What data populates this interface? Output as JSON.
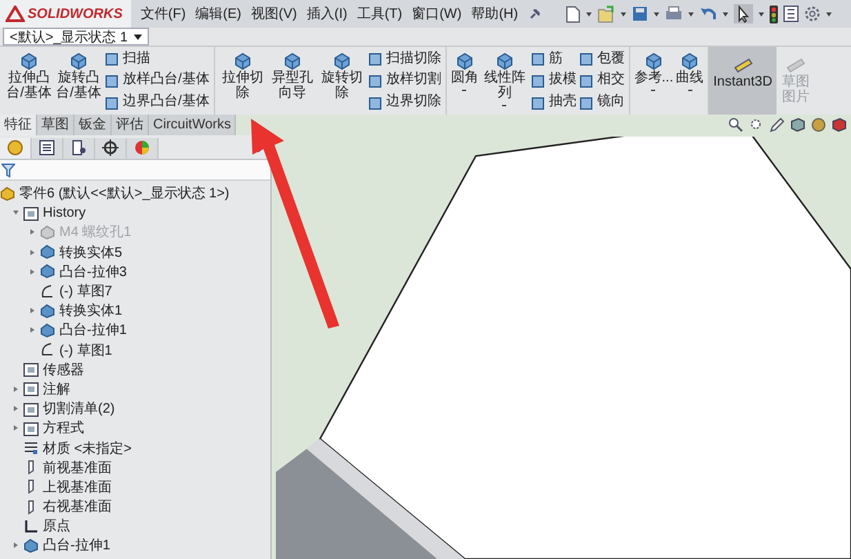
{
  "app": {
    "logo": "SOLIDWORKS"
  },
  "menu": [
    "文件(F)",
    "编辑(E)",
    "视图(V)",
    "插入(I)",
    "工具(T)",
    "窗口(W)",
    "帮助(H)"
  ],
  "config": {
    "value": "<默认>_显示状态 1"
  },
  "command_groups": [
    {
      "big": [
        {
          "label": "拉伸凸台/基体",
          "dropdown": false
        },
        {
          "label": "旋转凸台/基体",
          "dropdown": false
        }
      ],
      "small": [
        [
          "扫描",
          "放样凸台/基体",
          "边界凸台/基体"
        ]
      ]
    },
    {
      "big": [
        {
          "label": "拉伸切除",
          "dropdown": false
        },
        {
          "label": "异型孔向导",
          "dropdown": false
        },
        {
          "label": "旋转切除",
          "dropdown": false
        }
      ],
      "small": [
        [
          "扫描切除",
          "放样切割",
          "边界切除"
        ]
      ]
    },
    {
      "big": [
        {
          "label": "圆角",
          "dropdown": true
        },
        {
          "label": "线性阵列",
          "dropdown": true
        }
      ],
      "small": [
        [
          "筋",
          "拔模",
          "抽壳"
        ],
        [
          "包覆",
          "相交",
          "镜向"
        ]
      ]
    },
    {
      "big": [
        {
          "label": "参考...",
          "dropdown": true
        },
        {
          "label": "曲线",
          "dropdown": true
        }
      ]
    }
  ],
  "toggles": [
    {
      "label": "Instant3D",
      "selected": true,
      "disabled": false
    },
    {
      "label": "草图图片",
      "selected": false,
      "disabled": true
    }
  ],
  "tabs": [
    {
      "label": "特征",
      "selected": true
    },
    {
      "label": "草图",
      "selected": false
    },
    {
      "label": "钣金",
      "selected": false
    },
    {
      "label": "评估",
      "selected": false
    },
    {
      "label": "CircuitWorks",
      "selected": false
    }
  ],
  "tree": {
    "root": "零件6 (默认<<默认>_显示状态 1>)",
    "items": [
      {
        "label": "History",
        "kind": "folder",
        "expanded": true,
        "children": [
          {
            "label": "M4 螺纹孔1",
            "kind": "feature",
            "expanded": false,
            "suppressed": true
          },
          {
            "label": "转换实体5",
            "kind": "feature",
            "expanded": false,
            "suppressed": false
          },
          {
            "label": "凸台-拉伸3",
            "kind": "feature",
            "expanded": false,
            "suppressed": false
          },
          {
            "label": "(-) 草图7",
            "kind": "sketch",
            "suppressed": false
          },
          {
            "label": "转换实体1",
            "kind": "feature",
            "expanded": false,
            "suppressed": false
          },
          {
            "label": "凸台-拉伸1",
            "kind": "feature",
            "expanded": false,
            "suppressed": false
          },
          {
            "label": "(-) 草图1",
            "kind": "sketch",
            "suppressed": false
          }
        ]
      },
      {
        "label": "传感器",
        "kind": "folder"
      },
      {
        "label": "注解",
        "kind": "folder",
        "expanded": false
      },
      {
        "label": "切割清单(2)",
        "kind": "folder",
        "expanded": false
      },
      {
        "label": "方程式",
        "kind": "folder",
        "expanded": false
      },
      {
        "label": "材质 <未指定>",
        "kind": "material"
      },
      {
        "label": "前视基准面",
        "kind": "plane"
      },
      {
        "label": "上视基准面",
        "kind": "plane"
      },
      {
        "label": "右视基准面",
        "kind": "plane"
      },
      {
        "label": "原点",
        "kind": "origin"
      },
      {
        "label": "凸台-拉伸1",
        "kind": "feature",
        "expanded": false,
        "suppressed": false
      }
    ]
  }
}
